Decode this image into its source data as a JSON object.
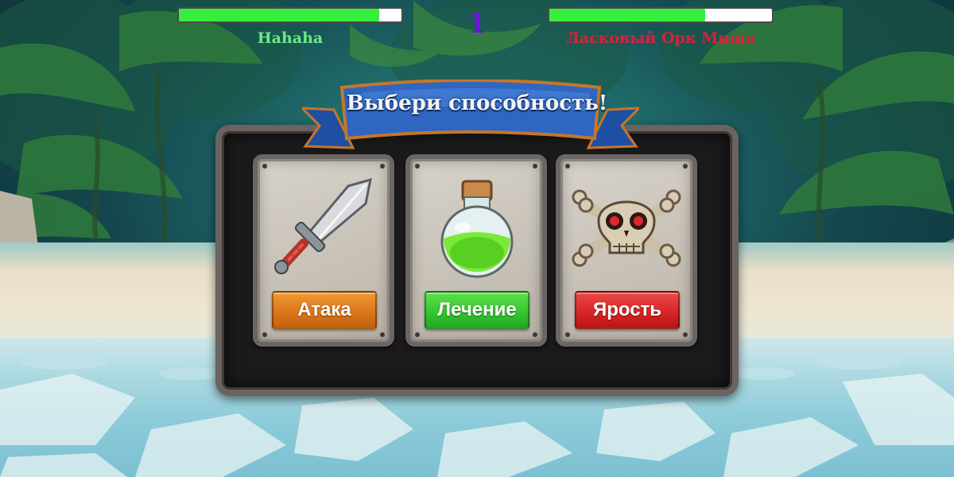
{
  "hud": {
    "player": {
      "name": "Hahaha",
      "hp_fraction": 0.9,
      "hp_color": "#35ee3d",
      "name_color": "#6ee88a"
    },
    "enemy": {
      "name": "Ласковый Орк Миша",
      "hp_fraction": 0.7,
      "hp_color": "#35ee3d",
      "name_color": "#d8223c"
    },
    "round": "1",
    "round_color": "#6c14d8"
  },
  "dialog": {
    "title": "Выбери способность!",
    "abilities": [
      {
        "label": "Атака",
        "icon": "sword-icon",
        "color": "#d9741a"
      },
      {
        "label": "Лечение",
        "icon": "potion-icon",
        "color": "#33c430"
      },
      {
        "label": "Ярость",
        "icon": "skull-crossbones-icon",
        "color": "#d62525"
      }
    ]
  }
}
